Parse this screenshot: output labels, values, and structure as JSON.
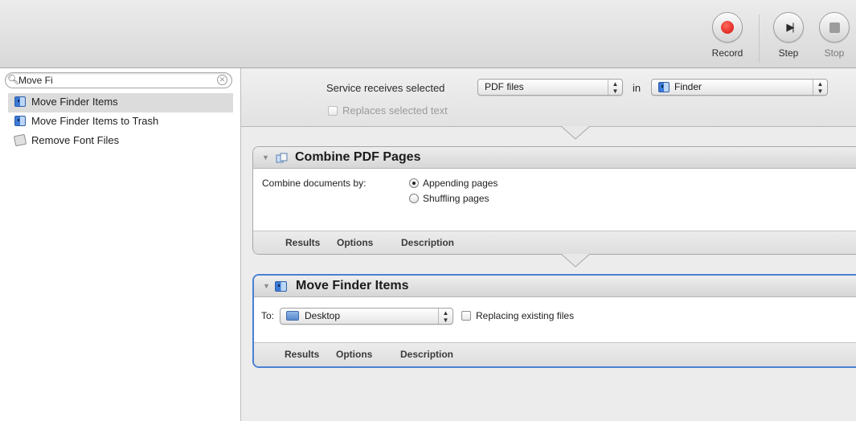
{
  "toolbar": {
    "record_label": "Record",
    "step_label": "Step",
    "stop_label": "Stop"
  },
  "library": {
    "search_value": "Move Fi",
    "results": [
      {
        "label": "Move Finder Items",
        "icon": "finder-icon",
        "selected": true
      },
      {
        "label": "Move Finder Items to Trash",
        "icon": "finder-icon",
        "selected": false
      },
      {
        "label": "Remove Font Files",
        "icon": "script-icon",
        "selected": false
      }
    ]
  },
  "service": {
    "receives_label": "Service receives selected",
    "input_type": "PDF files",
    "in_label": "in",
    "application": "Finder",
    "replaces_label": "Replaces selected text"
  },
  "actions": [
    {
      "title": "Combine PDF Pages",
      "combine_label": "Combine documents by:",
      "options": [
        "Appending pages",
        "Shuffling pages"
      ],
      "selected_option": "Appending pages",
      "tabs": [
        "Results",
        "Options",
        "Description"
      ]
    },
    {
      "title": "Move Finder Items",
      "to_label": "To:",
      "destination": "Desktop",
      "replacing_label": "Replacing existing files",
      "tabs": [
        "Results",
        "Options",
        "Description"
      ]
    }
  ],
  "colors": {
    "record_red": "#d60d0d",
    "selection_blue": "#4a7fd4"
  }
}
